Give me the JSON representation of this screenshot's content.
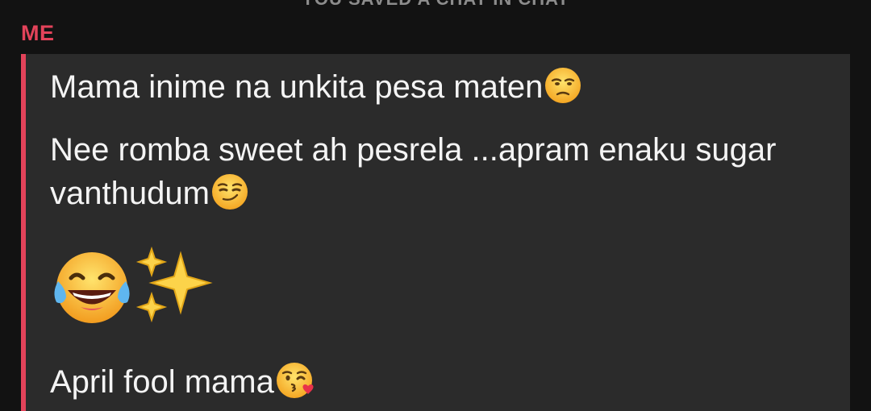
{
  "header": {
    "clipped_text": "YOU SAVED A CHAT IN CHAT"
  },
  "sender": {
    "label": "ME",
    "accent_color": "#e3435a"
  },
  "messages": [
    {
      "text": "Mama inime na unkita pesa maten",
      "emoji": "unamused-face-icon"
    },
    {
      "text": "Nee romba sweet ah pesrela ...apram enaku sugar vanthudum",
      "emoji": "smirking-face-icon"
    },
    {
      "text": "",
      "emoji": [
        "tears-of-joy-face-icon",
        "sparkles-icon"
      ]
    },
    {
      "text": "April fool mama",
      "emoji": "face-blowing-kiss-icon"
    }
  ],
  "colors": {
    "background": "#121212",
    "bubble": "#2b2b2b",
    "text": "#f4f4f4"
  }
}
